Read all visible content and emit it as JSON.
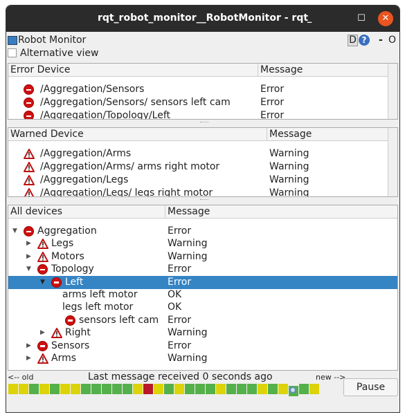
{
  "window": {
    "title": "rqt_robot_monitor__RobotMonitor - rqt",
    "minimize": "_",
    "maximize": "☐",
    "close": "✕"
  },
  "plugin": {
    "title": "Robot Monitor",
    "d_label": "D",
    "help": "?",
    "dash": "-",
    "o": "O"
  },
  "alt_view": {
    "label": "Alternative view",
    "checked": false
  },
  "error_table": {
    "headers": [
      "Error Device",
      "Message"
    ],
    "rows": [
      {
        "device": "/Aggregation/Sensors",
        "message": "Error"
      },
      {
        "device": "/Aggregation/Sensors/ sensors left cam",
        "message": "Error"
      },
      {
        "device": "/Aggregation/Topology/Left",
        "message": "Error"
      }
    ]
  },
  "warn_table": {
    "headers": [
      "Warned Device",
      "Message"
    ],
    "rows": [
      {
        "device": "/Aggregation/Arms",
        "message": "Warning"
      },
      {
        "device": "/Aggregation/Arms/ arms right motor",
        "message": "Warning"
      },
      {
        "device": "/Aggregation/Legs",
        "message": "Warning"
      },
      {
        "device": "/Aggregation/Legs/ legs right motor",
        "message": "Warning"
      }
    ]
  },
  "tree": {
    "headers": [
      "All devices",
      "Message"
    ],
    "rows": [
      {
        "name": "Aggregation",
        "message": "Error",
        "level": 0,
        "status": "error",
        "arrow": "expanded"
      },
      {
        "name": "Legs",
        "message": "Warning",
        "level": 1,
        "status": "warning",
        "arrow": "collapsed"
      },
      {
        "name": "Motors",
        "message": "Warning",
        "level": 1,
        "status": "warning",
        "arrow": "collapsed"
      },
      {
        "name": "Topology",
        "message": "Error",
        "level": 1,
        "status": "error",
        "arrow": "expanded"
      },
      {
        "name": "Left",
        "message": "Error",
        "level": 2,
        "status": "error",
        "arrow": "expanded",
        "selected": true
      },
      {
        "name": "arms left motor",
        "message": "OK",
        "level": 3,
        "status": "ok",
        "arrow": "none"
      },
      {
        "name": "legs left motor",
        "message": "OK",
        "level": 3,
        "status": "ok",
        "arrow": "none"
      },
      {
        "name": "sensors left cam",
        "message": "Error",
        "level": 3,
        "status": "error",
        "arrow": "none"
      },
      {
        "name": "Right",
        "message": "Warning",
        "level": 2,
        "status": "warning",
        "arrow": "collapsed"
      },
      {
        "name": "Sensors",
        "message": "Error",
        "level": 1,
        "status": "error",
        "arrow": "collapsed"
      },
      {
        "name": "Arms",
        "message": "Warning",
        "level": 1,
        "status": "warning",
        "arrow": "collapsed"
      }
    ]
  },
  "footer": {
    "old": "<-- old",
    "status": "Last message received 0 seconds ago",
    "new": "new -->",
    "pause": "Pause"
  },
  "timeline": [
    "warning",
    "warning",
    "ok",
    "warning",
    "ok",
    "warning",
    "warning",
    "ok",
    "ok",
    "ok",
    "ok",
    "ok",
    "warning",
    "error",
    "warning",
    "ok",
    "warning",
    "ok",
    "ok",
    "ok",
    "warning",
    "ok",
    "ok",
    "ok",
    "warning",
    "ok",
    "warning",
    "ok",
    "ok",
    "warning"
  ],
  "colors": {
    "ok": "#54b04a",
    "warning": "#dcd30a",
    "error": "#b8182a",
    "selection": "#3584c4"
  }
}
